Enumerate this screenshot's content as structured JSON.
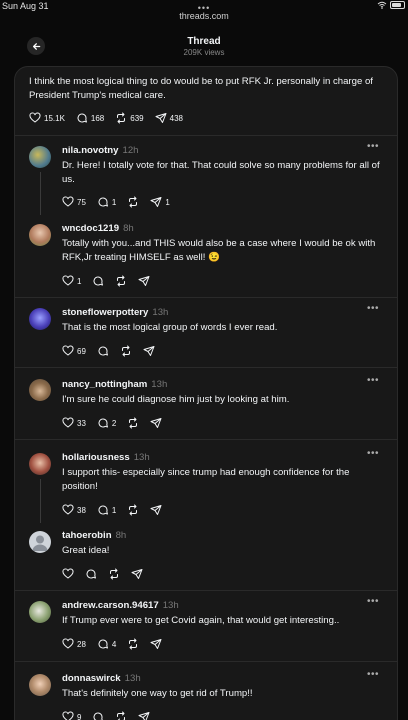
{
  "status": {
    "time": "Sun Aug 31"
  },
  "browser": {
    "url": "threads.com"
  },
  "header": {
    "title": "Thread",
    "views": "209K views"
  },
  "post": {
    "text": "I think the most logical thing to do would be to put RFK Jr. personally in charge of President Trump's medical care.",
    "likes": "15.1K",
    "replies": "168",
    "reposts": "639",
    "shares": "438"
  },
  "replies": [
    {
      "user": "nila.novotny",
      "time": "12h",
      "text": "Dr. Here! I totally vote for that. That could solve so many problems for all of us.",
      "likes": "75",
      "replies": "1",
      "reposts": "",
      "shares": "1"
    },
    {
      "user": "wncdoc1219",
      "time": "8h",
      "text": "Totally with you...and THIS would also be a case where I would be ok with RFK,Jr treating HIMSELF as well! 😉",
      "likes": "1",
      "replies": "",
      "reposts": "",
      "shares": ""
    },
    {
      "user": "stoneflowerpottery",
      "time": "13h",
      "text": "That is the most logical group of words I ever read.",
      "likes": "69",
      "replies": "",
      "reposts": "",
      "shares": ""
    },
    {
      "user": "nancy_nottingham",
      "time": "13h",
      "text": "I'm sure he could diagnose him just by looking at him.",
      "likes": "33",
      "replies": "2",
      "reposts": "",
      "shares": ""
    },
    {
      "user": "hollariousness",
      "time": "13h",
      "text": "I support this- especially since trump had enough confidence for the position!",
      "likes": "38",
      "replies": "1",
      "reposts": "",
      "shares": ""
    },
    {
      "user": "tahoerobin",
      "time": "8h",
      "text": "Great idea!",
      "likes": "",
      "replies": "",
      "reposts": "",
      "shares": ""
    },
    {
      "user": "andrew.carson.94617",
      "time": "13h",
      "text": "If Trump ever were to get Covid again, that would get interesting..",
      "likes": "28",
      "replies": "4",
      "reposts": "",
      "shares": ""
    },
    {
      "user": "donnaswirck",
      "time": "13h",
      "text": "That's definitely one way to get rid of Trump!!",
      "likes": "9",
      "replies": "",
      "reposts": "",
      "shares": ""
    }
  ],
  "colors": {
    "background": "#0a0a0a",
    "card": "#181818",
    "text": "#f3f5f7",
    "muted": "#777777"
  }
}
